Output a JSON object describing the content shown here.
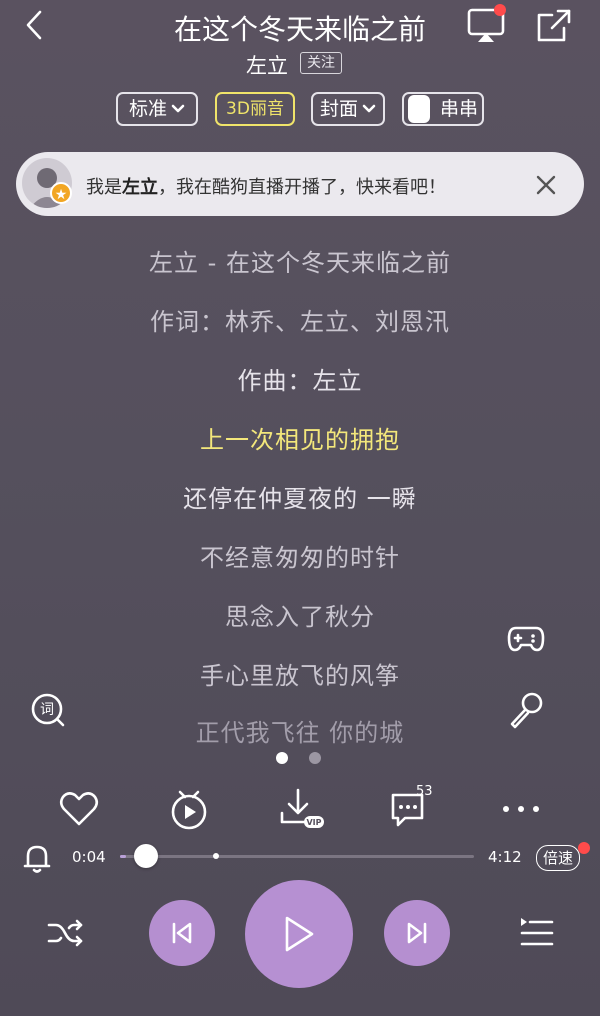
{
  "header": {
    "title": "在这个冬天来临之前",
    "artist": "左立",
    "follow_label": "关注"
  },
  "options": {
    "quality_label": "标准",
    "effect_label": "3D丽音",
    "cover_label": "封面",
    "chuan_label": "串串"
  },
  "notice": {
    "prefix": "我是",
    "name": "左立",
    "suffix": "，我在酷狗直播开播了，快来看吧！",
    "badge": "★"
  },
  "lyrics": [
    "左立 - 在这个冬天来临之前",
    "作词：林乔、左立、刘恩汛",
    "作曲：左立",
    "上一次相见的拥抱",
    "还停在仲夏夜的 一瞬",
    "不经意匆匆的时针",
    "思念入了秋分",
    "手心里放飞的风筝",
    "正代我飞往 你的城"
  ],
  "current_lyric_index": 3,
  "actions": {
    "comment_count": "53",
    "download_badge": "VIP"
  },
  "player": {
    "current_time": "0:04",
    "total_time": "4:12",
    "progress_fraction": 0.016,
    "buffered_fraction": 0.27,
    "speed_label": "倍速"
  },
  "colors": {
    "highlight": "#f3e77b",
    "accent": "#b58fd0",
    "notification_dot": "#ff4b4b"
  },
  "icons": [
    "back-icon",
    "cast-icon",
    "share-icon",
    "close-icon",
    "lyric-mode-icon",
    "game-icon",
    "mic-icon",
    "heart-icon",
    "mv-icon",
    "download-icon",
    "comment-icon",
    "more-icon",
    "bell-icon",
    "shuffle-icon",
    "prev-icon",
    "play-icon",
    "next-icon",
    "queue-icon"
  ]
}
